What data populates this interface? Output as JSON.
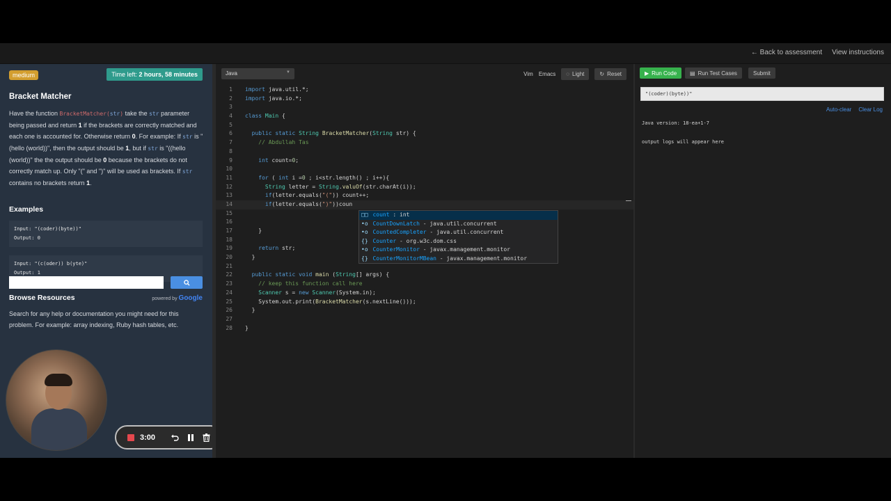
{
  "nav": {
    "back": "← Back to assessment",
    "instructions": "View instructions"
  },
  "problem": {
    "difficulty": "medium",
    "time_prefix": "Time left: ",
    "time_value": "2 hours, 58 minutes",
    "title": "Bracket Matcher",
    "desc": {
      "p1": "Have the function ",
      "fn": "BracketMatcher(",
      "arg1": "str",
      "p1b": ")",
      "p2": " take the ",
      "arg2": "str",
      "p3": " parameter being passed and return ",
      "one": "1",
      "p4": " if the brackets are correctly matched and each one is accounted for. Otherwise return ",
      "zero": "0",
      "p5": ". For example: If ",
      "arg3": "str",
      "p6": " is \"(hello (world))\", then the output should be ",
      "one2": "1",
      "p7": ", but if ",
      "arg4": "str",
      "p8": " is \"((hello (world))\" the the output should be ",
      "zero2": "0",
      "p9": " because the brackets do not correctly match up. Only \"(\" and \")\" will be used as brackets. If ",
      "arg5": "str",
      "p10": " contains no brackets return ",
      "one3": "1",
      "p11": "."
    },
    "examples_title": "Examples",
    "examples": [
      {
        "input": "Input: \"(coder)(byte))\"",
        "output": "Output: 0"
      },
      {
        "input": "Input: \"(c(oder)) b(yte)\"",
        "output": "Output: 1"
      }
    ],
    "browse_title": "Browse Resources",
    "powered_by": "powered by",
    "google": "Google",
    "browse_desc": "Search for any help or documentation you might need for this problem. For example: array indexing, Ruby hash tables, etc.",
    "search_placeholder": ""
  },
  "recorder": {
    "time": "3:00"
  },
  "editor": {
    "language": "Java",
    "vim": "Vim",
    "emacs": "Emacs",
    "light": "Light",
    "reset": "Reset",
    "autocomplete": [
      {
        "icon": "□□",
        "name": "count",
        "detail": " : int"
      },
      {
        "icon": "•o",
        "name": "CountDownLatch",
        "detail": " - java.util.concurrent"
      },
      {
        "icon": "•o",
        "name": "CountedCompleter",
        "detail": " - java.util.concurrent"
      },
      {
        "icon": "{}",
        "name": "Counter",
        "detail": " - org.w3c.dom.css"
      },
      {
        "icon": "•o",
        "name": "CounterMonitor",
        "detail": " - javax.management.monitor"
      },
      {
        "icon": "{}",
        "name": "CounterMonitorMBean",
        "detail": " - javax.management.monitor"
      }
    ]
  },
  "console": {
    "run": "Run Code",
    "tests": "Run Test Cases",
    "submit": "Submit",
    "input_value": "\"(coder)(byte))\"",
    "autoclear": "Auto-clear",
    "clearlog": "Clear Log",
    "java_version": "Java version: 18-ea+1-7",
    "logs_note": "output logs will appear here"
  },
  "colors": {
    "accent_green": "#37b24d",
    "badge": "#d39e2f",
    "timer": "#2f9b8c",
    "link": "#4a8fe2"
  }
}
